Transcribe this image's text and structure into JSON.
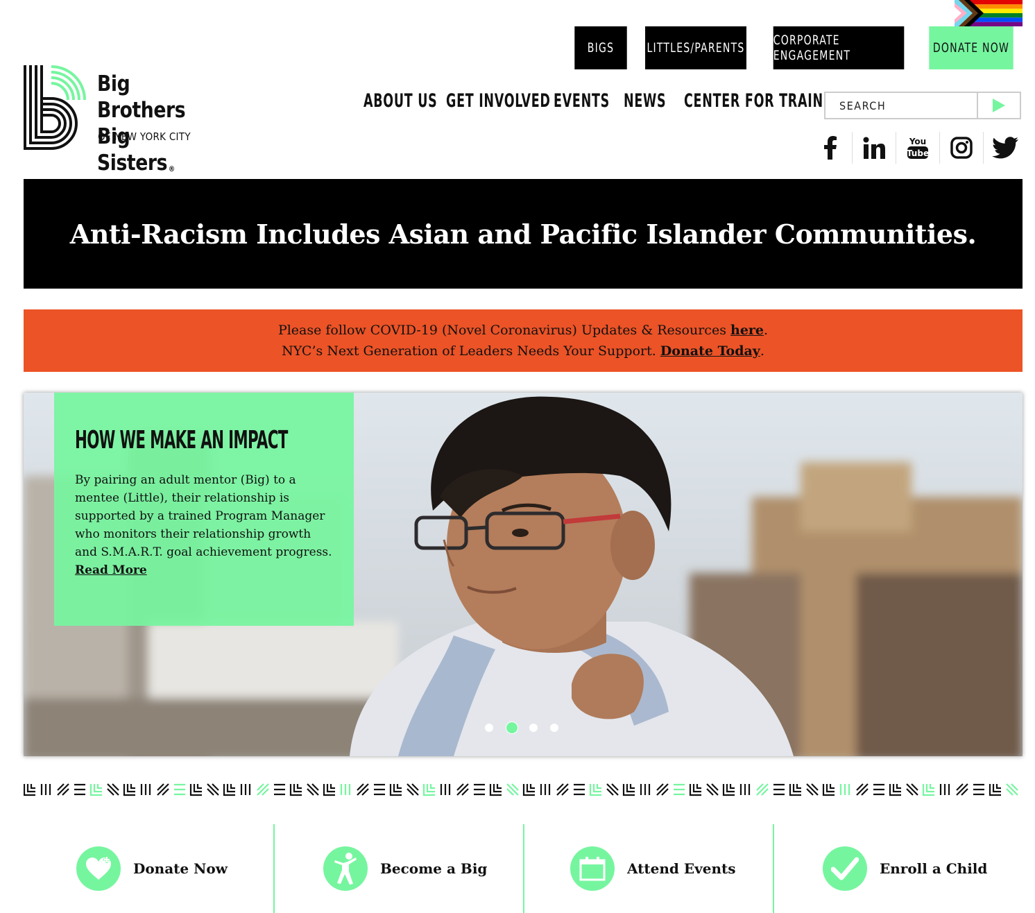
{
  "top_nav": {
    "bigs": "BIGS",
    "littles_parents": "LITTLES/PARENTS",
    "corporate": "CORPORATE ENGAGEMENT",
    "donate": "DONATE NOW"
  },
  "logo": {
    "line1": "Big Brothers",
    "line2": "Big Sisters",
    "registered": "®",
    "sub": "OF NEW YORK CITY"
  },
  "main_nav": {
    "about": "ABOUT US",
    "involved": "GET INVOLVED",
    "events": "EVENTS",
    "news": "NEWS",
    "training": "CENTER FOR TRAINING"
  },
  "search": {
    "placeholder": "SEARCH"
  },
  "social": [
    "facebook-icon",
    "linkedin-icon",
    "youtube-icon",
    "instagram-icon",
    "twitter-icon"
  ],
  "banner": {
    "title": "Anti-Racism Includes Asian and Pacific Islander Communities."
  },
  "alert": {
    "line1_prefix": "Please follow COVID-19 (Novel Coronavirus) Updates & Resources ",
    "line1_link": "here",
    "line1_suffix": ".",
    "line2_prefix": "NYC’s Next Generation of Leaders Needs Your Support. ",
    "line2_link": "Donate Today",
    "line2_suffix": "."
  },
  "hero": {
    "title": "HOW WE MAKE AN IMPACT",
    "body": "By pairing an adult mentor (Big) to a mentee (Little), their relationship is supported by a trained Program Manager who monitors their relationship growth and S.M.A.R.T. goal achievement progress.",
    "read_more": "Read More",
    "active_slide": 2,
    "slide_count": 4
  },
  "cta": {
    "donate": "Donate Now",
    "become": "Become a Big",
    "events": "Attend Events",
    "enroll": "Enroll a Child"
  },
  "colors": {
    "accent_green": "#76f59f",
    "alert_orange": "#ec5326",
    "black": "#000000"
  }
}
